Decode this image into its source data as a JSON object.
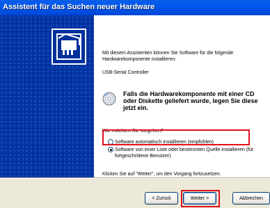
{
  "window": {
    "title": "Assistent für das Suchen neuer Hardware"
  },
  "content": {
    "intro": "Mit diesem Assistenten können Sie Software für die folgende Hardwarekomponente installieren:",
    "device": "USB-Serial Controller",
    "cd_hint": "Falls die Hardwarekomponente mit einer CD oder Diskette geliefert wurde, legen Sie diese jetzt ein.",
    "question": "Wie möchten Sie vorgehen?",
    "options": [
      {
        "label": "Software automatisch installieren (empfohlen)",
        "selected": false
      },
      {
        "label": "Software von einer Liste oder bestimmten Quelle installieren (für fortgeschrittene Benutzer)",
        "selected": true
      }
    ],
    "instruction": "Klicken Sie auf \"Weiter\", um den Vorgang fortzusetzen."
  },
  "buttons": {
    "back": "< Zurück",
    "next": "Weiter >",
    "cancel": "Abbrechen"
  },
  "colors": {
    "title_bar": "#0054e3",
    "left_pane": "#00309c",
    "highlight": "#e0101c",
    "dialog_bg": "#ece9d8"
  },
  "icons": {
    "wizard": "hardware-card-icon",
    "cd": "cd-icon"
  }
}
